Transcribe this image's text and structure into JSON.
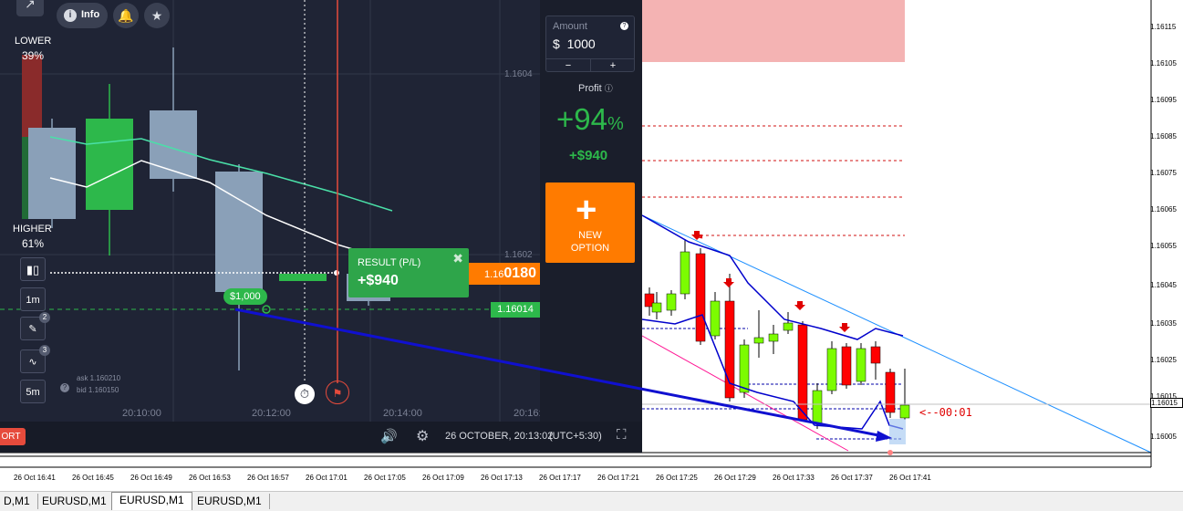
{
  "iq": {
    "info_label": "Info",
    "lower_label": "LOWER",
    "lower_pct": "39%",
    "higher_label": "HIGHER",
    "higher_pct": "61%",
    "price_top": "1.1604",
    "price_mid": "1.1602",
    "current_price_prefix": "1.16",
    "current_price_suffix": "0180",
    "strike_price": "1.16014",
    "bet_badge": "$1,000",
    "ask": "ask 1.160210",
    "bid": "bid 1.160150",
    "time_labels": [
      "20:10:00",
      "20:12:00",
      "20:14:00",
      "20:16:"
    ],
    "tools": {
      "candles": "",
      "interval": "1m",
      "draw_badge": "2",
      "indicator_badge": "3",
      "interval2": "5m"
    },
    "result": {
      "title": "RESULT (P/L)",
      "value": "+$940"
    },
    "amount": {
      "label": "Amount",
      "currency": "$",
      "value": "1000",
      "minus": "−",
      "plus": "+"
    },
    "profit": {
      "label": "Profit",
      "pct_sign": "+",
      "pct": "94",
      "pct_unit": "%",
      "value": "+$940"
    },
    "new_option": {
      "line1": "NEW",
      "line2": "OPTION"
    },
    "bottom": {
      "left_btn": "ORT",
      "datetime": "26 OCTOBER, 20:13:02",
      "tz": "(UTC+5:30)"
    }
  },
  "mt4": {
    "price_labels": [
      "1.16115",
      "1.16105",
      "1.16095",
      "1.16085",
      "1.16075",
      "1.16065",
      "1.16055",
      "1.16045",
      "1.16035",
      "1.16025",
      "1.16015",
      "1.16005"
    ],
    "current_price": "1.16015",
    "timer": "<--00:01",
    "time_labels": [
      "26 Oct 16:41",
      "26 Oct 16:45",
      "26 Oct 16:49",
      "26 Oct 16:53",
      "26 Oct 16:57",
      "26 Oct 17:01",
      "26 Oct 17:05",
      "26 Oct 17:09",
      "26 Oct 17:13",
      "26 Oct 17:17",
      "26 Oct 17:21",
      "26 Oct 17:25",
      "26 Oct 17:29",
      "26 Oct 17:33",
      "26 Oct 17:37",
      "26 Oct 17:41"
    ],
    "tabs": [
      "D,M1",
      "EURUSD,M1",
      "EURUSD,M1",
      "EURUSD,M1"
    ],
    "active_tab": 2
  },
  "colors": {
    "bull": "#2db84b",
    "bear_grey": "#8aa0b8",
    "mt_red": "#ff0000",
    "mt_green": "#7cfc00",
    "orange": "#ff7b00",
    "blue_line": "#0000cc"
  }
}
